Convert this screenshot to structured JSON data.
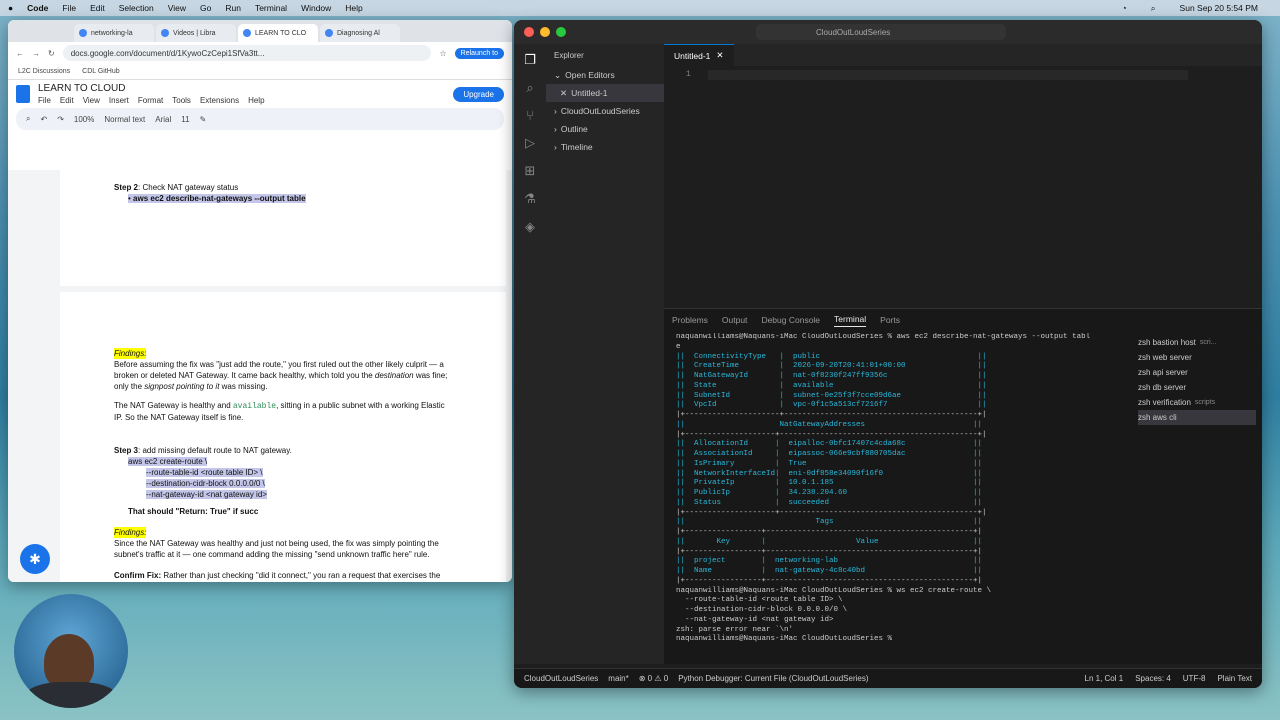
{
  "menubar": {
    "apple": "",
    "app": "Code",
    "items": [
      "File",
      "Edit",
      "Selection",
      "View",
      "Go",
      "Run",
      "Terminal",
      "Window",
      "Help"
    ],
    "clock": "Sun Sep 20  5:54 PM"
  },
  "chrome": {
    "tabs": [
      "networking-la",
      "Videos | Libra",
      "LEARN TO CLO",
      "Diagnosing Al"
    ],
    "url": "docs.google.com/document/d/1KywoCzCepi1SfVa3tt...",
    "relaunch": "Relaunch to",
    "bookmarks": [
      "L2C Discussions",
      "CDL GitHub"
    ]
  },
  "gdocs": {
    "title": "LEARN TO CLOUD",
    "menu": [
      "File",
      "Edit",
      "View",
      "Insert",
      "Format",
      "Tools",
      "Extensions",
      "Help"
    ],
    "upgrade": "Upgrade",
    "zoom": "100%",
    "style": "Normal text",
    "font": "Arial",
    "size": "11",
    "step2_label": "Step 2",
    "step2_text": ": Check NAT gateway status",
    "step2_cmd": "aws ec2 describe-nat-gateways --output table",
    "findings": "Findings:",
    "p1a": "Before assuming the fix was \"just add the route,\" you first ruled out the other likely culprit — a broken or deleted NAT Gateway. It came back healthy, which told you the ",
    "p1_dest": "destination",
    "p1b": " was fine; only the ",
    "p1_sig": "signpost pointing to it",
    "p1c": " was missing.",
    "p2a": "The NAT Gateway is healthy and ",
    "p2_avail": "available",
    "p2b": ", sitting in a public subnet with a working Elastic IP. So the NAT Gateway itself is fine.",
    "step3_label": "Step 3",
    "step3_text": ": add missing default route to NAT gateway.",
    "cmd1": "aws ec2 create-route \\",
    "cmd2": "--route-table-id <route table ID> \\",
    "cmd3": "--destination-cidr-block 0.0.0.0/0 \\",
    "cmd4": "--nat-gateway-id <nat gateway id>",
    "should": "That should \"Return: True\" if succ",
    "findings2": "Findings:",
    "p3": "Since the NAT Gateway was healthy and just not being used, the fix was simply pointing the subnet's traffic at it — one command adding the missing \"send unknown traffic here\" rule.",
    "confirm_label": "Confirm Fix:",
    "confirm": " Rather than just checking \"did it connect,\" you ran a request that exercises the"
  },
  "vscode": {
    "title": "CloudOutLoudSeries",
    "explorer": "Explorer",
    "open_editors": "Open Editors",
    "open_file": "Untitled-1",
    "folder": "CloudOutLoudSeries",
    "outline": "Outline",
    "timeline": "Timeline",
    "tab": "Untitled-1",
    "line_no": "1",
    "panel_tabs": [
      "Problems",
      "Output",
      "Debug Console",
      "Terminal",
      "Ports"
    ],
    "terminals": [
      {
        "name": "zsh  bastion host",
        "tag": "scri..."
      },
      {
        "name": "zsh  web server",
        "tag": ""
      },
      {
        "name": "zsh  api server",
        "tag": ""
      },
      {
        "name": "zsh  db server",
        "tag": ""
      },
      {
        "name": "zsh  verification",
        "tag": "scripts"
      },
      {
        "name": "zsh  aws cli",
        "tag": ""
      }
    ],
    "status": {
      "branch": "main*",
      "problems": "⊗ 0  ⚠ 0",
      "debug": "Python Debugger: Current File (CloudOutLoudSeries)",
      "pos": "Ln 1, Col 1",
      "spaces": "Spaces: 4",
      "enc": "UTF-8",
      "lang": "Plain Text",
      "folder": "CloudOutLoudSeries"
    }
  },
  "terminal_lines": [
    "naquanwilliams@Naquans-iMac CloudOutLoudSeries % aws ec2 describe-nat-gateways --output tabl",
    "e",
    "||  ConnectivityType   |  public                                   ||",
    "||  CreateTime         |  2026-09-20T20:41:01+00:00                ||",
    "||  NatGatewayId       |  nat-0f8230f247ff9356c                    ||",
    "||  State              |  available                                ||",
    "||  SubnetId           |  subnet-0e25f3f7cce09d6ae                 ||",
    "||  VpcId              |  vpc-0f1c5a513cf7216f7                    ||",
    "|+---------------------+-------------------------------------------+|",
    "||                     NatGatewayAddresses                        ||",
    "|+--------------------+--------------------------------------------+|",
    "||  AllocationId      |  eipalloc-0bfc17407c4cda68c               ||",
    "||  AssociationId     |  eipassoc-066e9cbf880705dac               ||",
    "||  IsPrimary         |  True                                     ||",
    "||  NetworkInterfaceId|  eni-0df858e34090f16f0                    ||",
    "||  PrivateIp         |  10.0.1.185                               ||",
    "||  PublicIp          |  34.238.204.60                            ||",
    "||  Status            |  succeeded                                ||",
    "|+--------------------+--------------------------------------------+|",
    "||                             Tags                               ||",
    "|+-----------------+----------------------------------------------+|",
    "||       Key       |                    Value                     ||",
    "|+-----------------+----------------------------------------------+|",
    "||  project        |  networking-lab                              ||",
    "||  Name           |  nat-gateway-4c8c40bd                        ||",
    "|+-----------------+----------------------------------------------+|",
    "naquanwilliams@Naquans-iMac CloudOutLoudSeries % ws ec2 create-route \\",
    "  --route-table-id <route table ID> \\",
    "  --destination-cidr-block 0.0.0.0/0 \\",
    "  --nat-gateway-id <nat gateway id>",
    "",
    "zsh: parse error near `\\n'",
    "naquanwilliams@Naquans-iMac CloudOutLoudSeries % "
  ]
}
